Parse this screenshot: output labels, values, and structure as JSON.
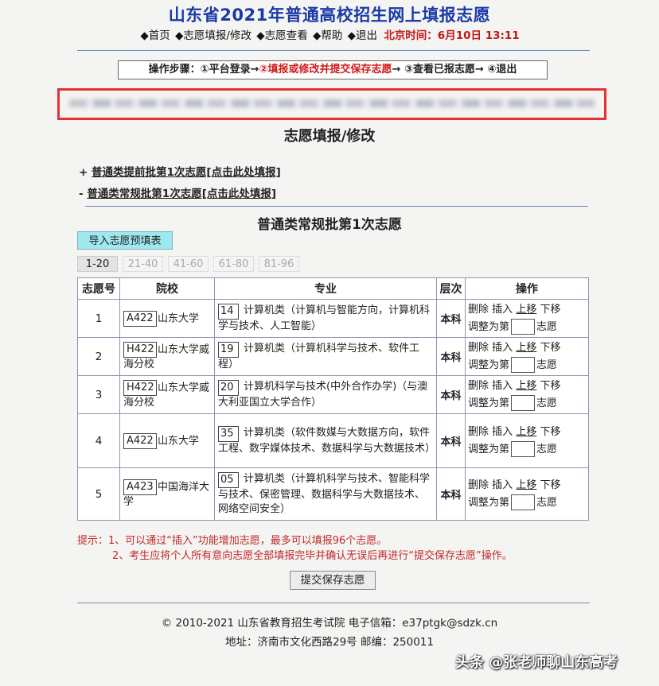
{
  "header": {
    "title": "山东省2021年普通高校招生网上填报志愿",
    "nav": [
      {
        "label": "◆首页"
      },
      {
        "label": "◆志愿填报/修改"
      },
      {
        "label": "◆志愿查看"
      },
      {
        "label": "◆帮助"
      },
      {
        "label": "◆退出"
      }
    ],
    "time_label": "北京时间：6月10日 13:11"
  },
  "steps": {
    "prefix": "操作步骤：",
    "step1": "①平台登录→",
    "step2": "②填报或修改并提交保存志愿",
    "step3": "→ ③查看已报志愿→ ④退出"
  },
  "section_title": "志愿填报/修改",
  "batches": [
    {
      "sign": "+",
      "link": "普通类提前批第1次志愿[点击此处填报]"
    },
    {
      "sign": "-",
      "link": "普通类常规批第1次志愿[点击此处填报]"
    }
  ],
  "sub_title": "普通类常规批第1次志愿",
  "import_button": "导入志愿预填表",
  "tabs": [
    "1-20",
    "21-40",
    "41-60",
    "61-80",
    "81-96"
  ],
  "table": {
    "headers": [
      "志愿号",
      "院校",
      "专业",
      "层次",
      "操作"
    ],
    "ops": {
      "delete": "删除",
      "insert": "插入",
      "up": "上移",
      "down": "下移",
      "adjust_prefix": "调整为第",
      "adjust_suffix": "志愿"
    },
    "rows": [
      {
        "no": "1",
        "school_code": "A422",
        "school_name": "山东大学",
        "major_code": "14",
        "major_name": "计算机类（计算机与智能方向，计算机科学与技术、人工智能）",
        "level": "本科"
      },
      {
        "no": "2",
        "school_code": "H422",
        "school_name": "山东大学威海分校",
        "major_code": "19",
        "major_name": "计算机类（计算机科学与技术、软件工程）",
        "level": "本科"
      },
      {
        "no": "3",
        "school_code": "H422",
        "school_name": "山东大学威海分校",
        "major_code": "20",
        "major_name": "计算机科学与技术(中外合作办学)（与澳大利亚国立大学合作）",
        "level": "本科"
      },
      {
        "no": "4",
        "school_code": "A422",
        "school_name": "山东大学",
        "major_code": "35",
        "major_name": "计算机类（软件数媒与大数据方向，软件工程、数字媒体技术、数据科学与大数据技术）",
        "level": "本科"
      },
      {
        "no": "5",
        "school_code": "A423",
        "school_name": "中国海洋大学",
        "major_code": "05",
        "major_name": "计算机类（计算机科学与技术、智能科学与技术、保密管理、数据科学与大数据技术、网络空间安全）",
        "level": "本科"
      }
    ]
  },
  "hints": {
    "line1": "提示：1、可以通过“插入”功能增加志愿，最多可以填报96个志愿。",
    "line2": "2、考生应将个人所有意向志愿全部填报完毕并确认无误后再进行“提交保存志愿”操作。"
  },
  "submit_button": "提交保存志愿",
  "footer": {
    "copyright": "© 2010-2021 山东省教育招生考试院 电子信箱：e37ptgk@sdzk.cn",
    "address": "地址：济南市文化西路29号 邮编：250011"
  },
  "watermark": "头条 @张老师聊山东高考",
  "colors": {
    "title_blue": "#1a3aa8",
    "alert_red": "#c01818",
    "import_button_bg": "#9fe8ef",
    "highlight_frame": "#e53131"
  }
}
